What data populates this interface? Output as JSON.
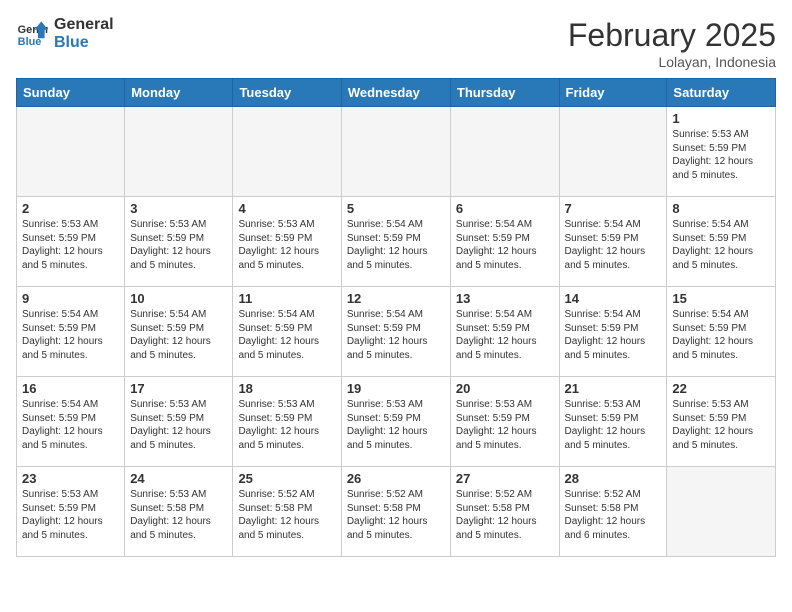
{
  "header": {
    "logo_line1": "General",
    "logo_line2": "Blue",
    "month_title": "February 2025",
    "location": "Lolayan, Indonesia"
  },
  "weekdays": [
    "Sunday",
    "Monday",
    "Tuesday",
    "Wednesday",
    "Thursday",
    "Friday",
    "Saturday"
  ],
  "weeks": [
    [
      {
        "day": "",
        "text": ""
      },
      {
        "day": "",
        "text": ""
      },
      {
        "day": "",
        "text": ""
      },
      {
        "day": "",
        "text": ""
      },
      {
        "day": "",
        "text": ""
      },
      {
        "day": "",
        "text": ""
      },
      {
        "day": "1",
        "text": "Sunrise: 5:53 AM\nSunset: 5:59 PM\nDaylight: 12 hours\nand 5 minutes."
      }
    ],
    [
      {
        "day": "2",
        "text": "Sunrise: 5:53 AM\nSunset: 5:59 PM\nDaylight: 12 hours\nand 5 minutes."
      },
      {
        "day": "3",
        "text": "Sunrise: 5:53 AM\nSunset: 5:59 PM\nDaylight: 12 hours\nand 5 minutes."
      },
      {
        "day": "4",
        "text": "Sunrise: 5:53 AM\nSunset: 5:59 PM\nDaylight: 12 hours\nand 5 minutes."
      },
      {
        "day": "5",
        "text": "Sunrise: 5:54 AM\nSunset: 5:59 PM\nDaylight: 12 hours\nand 5 minutes."
      },
      {
        "day": "6",
        "text": "Sunrise: 5:54 AM\nSunset: 5:59 PM\nDaylight: 12 hours\nand 5 minutes."
      },
      {
        "day": "7",
        "text": "Sunrise: 5:54 AM\nSunset: 5:59 PM\nDaylight: 12 hours\nand 5 minutes."
      },
      {
        "day": "8",
        "text": "Sunrise: 5:54 AM\nSunset: 5:59 PM\nDaylight: 12 hours\nand 5 minutes."
      }
    ],
    [
      {
        "day": "9",
        "text": "Sunrise: 5:54 AM\nSunset: 5:59 PM\nDaylight: 12 hours\nand 5 minutes."
      },
      {
        "day": "10",
        "text": "Sunrise: 5:54 AM\nSunset: 5:59 PM\nDaylight: 12 hours\nand 5 minutes."
      },
      {
        "day": "11",
        "text": "Sunrise: 5:54 AM\nSunset: 5:59 PM\nDaylight: 12 hours\nand 5 minutes."
      },
      {
        "day": "12",
        "text": "Sunrise: 5:54 AM\nSunset: 5:59 PM\nDaylight: 12 hours\nand 5 minutes."
      },
      {
        "day": "13",
        "text": "Sunrise: 5:54 AM\nSunset: 5:59 PM\nDaylight: 12 hours\nand 5 minutes."
      },
      {
        "day": "14",
        "text": "Sunrise: 5:54 AM\nSunset: 5:59 PM\nDaylight: 12 hours\nand 5 minutes."
      },
      {
        "day": "15",
        "text": "Sunrise: 5:54 AM\nSunset: 5:59 PM\nDaylight: 12 hours\nand 5 minutes."
      }
    ],
    [
      {
        "day": "16",
        "text": "Sunrise: 5:54 AM\nSunset: 5:59 PM\nDaylight: 12 hours\nand 5 minutes."
      },
      {
        "day": "17",
        "text": "Sunrise: 5:53 AM\nSunset: 5:59 PM\nDaylight: 12 hours\nand 5 minutes."
      },
      {
        "day": "18",
        "text": "Sunrise: 5:53 AM\nSunset: 5:59 PM\nDaylight: 12 hours\nand 5 minutes."
      },
      {
        "day": "19",
        "text": "Sunrise: 5:53 AM\nSunset: 5:59 PM\nDaylight: 12 hours\nand 5 minutes."
      },
      {
        "day": "20",
        "text": "Sunrise: 5:53 AM\nSunset: 5:59 PM\nDaylight: 12 hours\nand 5 minutes."
      },
      {
        "day": "21",
        "text": "Sunrise: 5:53 AM\nSunset: 5:59 PM\nDaylight: 12 hours\nand 5 minutes."
      },
      {
        "day": "22",
        "text": "Sunrise: 5:53 AM\nSunset: 5:59 PM\nDaylight: 12 hours\nand 5 minutes."
      }
    ],
    [
      {
        "day": "23",
        "text": "Sunrise: 5:53 AM\nSunset: 5:59 PM\nDaylight: 12 hours\nand 5 minutes."
      },
      {
        "day": "24",
        "text": "Sunrise: 5:53 AM\nSunset: 5:58 PM\nDaylight: 12 hours\nand 5 minutes."
      },
      {
        "day": "25",
        "text": "Sunrise: 5:52 AM\nSunset: 5:58 PM\nDaylight: 12 hours\nand 5 minutes."
      },
      {
        "day": "26",
        "text": "Sunrise: 5:52 AM\nSunset: 5:58 PM\nDaylight: 12 hours\nand 5 minutes."
      },
      {
        "day": "27",
        "text": "Sunrise: 5:52 AM\nSunset: 5:58 PM\nDaylight: 12 hours\nand 5 minutes."
      },
      {
        "day": "28",
        "text": "Sunrise: 5:52 AM\nSunset: 5:58 PM\nDaylight: 12 hours\nand 6 minutes."
      },
      {
        "day": "",
        "text": ""
      }
    ]
  ]
}
